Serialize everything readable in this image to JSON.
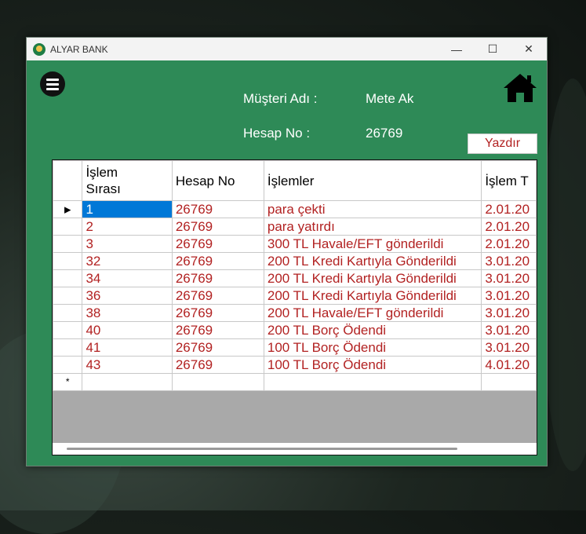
{
  "window": {
    "title": "ALYAR BANK",
    "controls": {
      "minimize": "—",
      "maximize": "☐",
      "close": "✕"
    }
  },
  "header": {
    "customer_label": "Müşteri Adı :",
    "customer_value": "Mete Ak",
    "account_label": "Hesap No :",
    "account_value": "26769",
    "print_button": "Yazdır"
  },
  "grid": {
    "columns": [
      "İşlem\nSırası",
      "Hesap No",
      "İşlemler",
      "İşlem T"
    ],
    "rows": [
      {
        "sira": "1",
        "hesap": "26769",
        "islem": "para çekti",
        "tarih": "2.01.20"
      },
      {
        "sira": "2",
        "hesap": "26769",
        "islem": "para yatırdı",
        "tarih": "2.01.20"
      },
      {
        "sira": "3",
        "hesap": "26769",
        "islem": "300 TL Havale/EFT gönderildi",
        "tarih": "2.01.20"
      },
      {
        "sira": "32",
        "hesap": "26769",
        "islem": "200 TL Kredi Kartıyla Gönderildi",
        "tarih": "3.01.20"
      },
      {
        "sira": "34",
        "hesap": "26769",
        "islem": "200 TL Kredi Kartıyla Gönderildi",
        "tarih": "3.01.20"
      },
      {
        "sira": "36",
        "hesap": "26769",
        "islem": "200 TL Kredi Kartıyla Gönderildi",
        "tarih": "3.01.20"
      },
      {
        "sira": "38",
        "hesap": "26769",
        "islem": "200 TL Havale/EFT gönderildi",
        "tarih": "3.01.20"
      },
      {
        "sira": "40",
        "hesap": "26769",
        "islem": "200 TL Borç Ödendi",
        "tarih": "3.01.20"
      },
      {
        "sira": "41",
        "hesap": "26769",
        "islem": "100 TL Borç Ödendi",
        "tarih": "3.01.20"
      },
      {
        "sira": "43",
        "hesap": "26769",
        "islem": "100 TL Borç Ödendi",
        "tarih": "4.01.20"
      }
    ],
    "current_row_marker": "▸",
    "new_row_marker": "*"
  },
  "colors": {
    "window_bg": "#2e8a57",
    "cell_text": "#b22222",
    "selection": "#0078d7"
  },
  "icons": {
    "menu": "hamburger-icon",
    "home": "home-icon",
    "app": "bank-logo-icon"
  }
}
